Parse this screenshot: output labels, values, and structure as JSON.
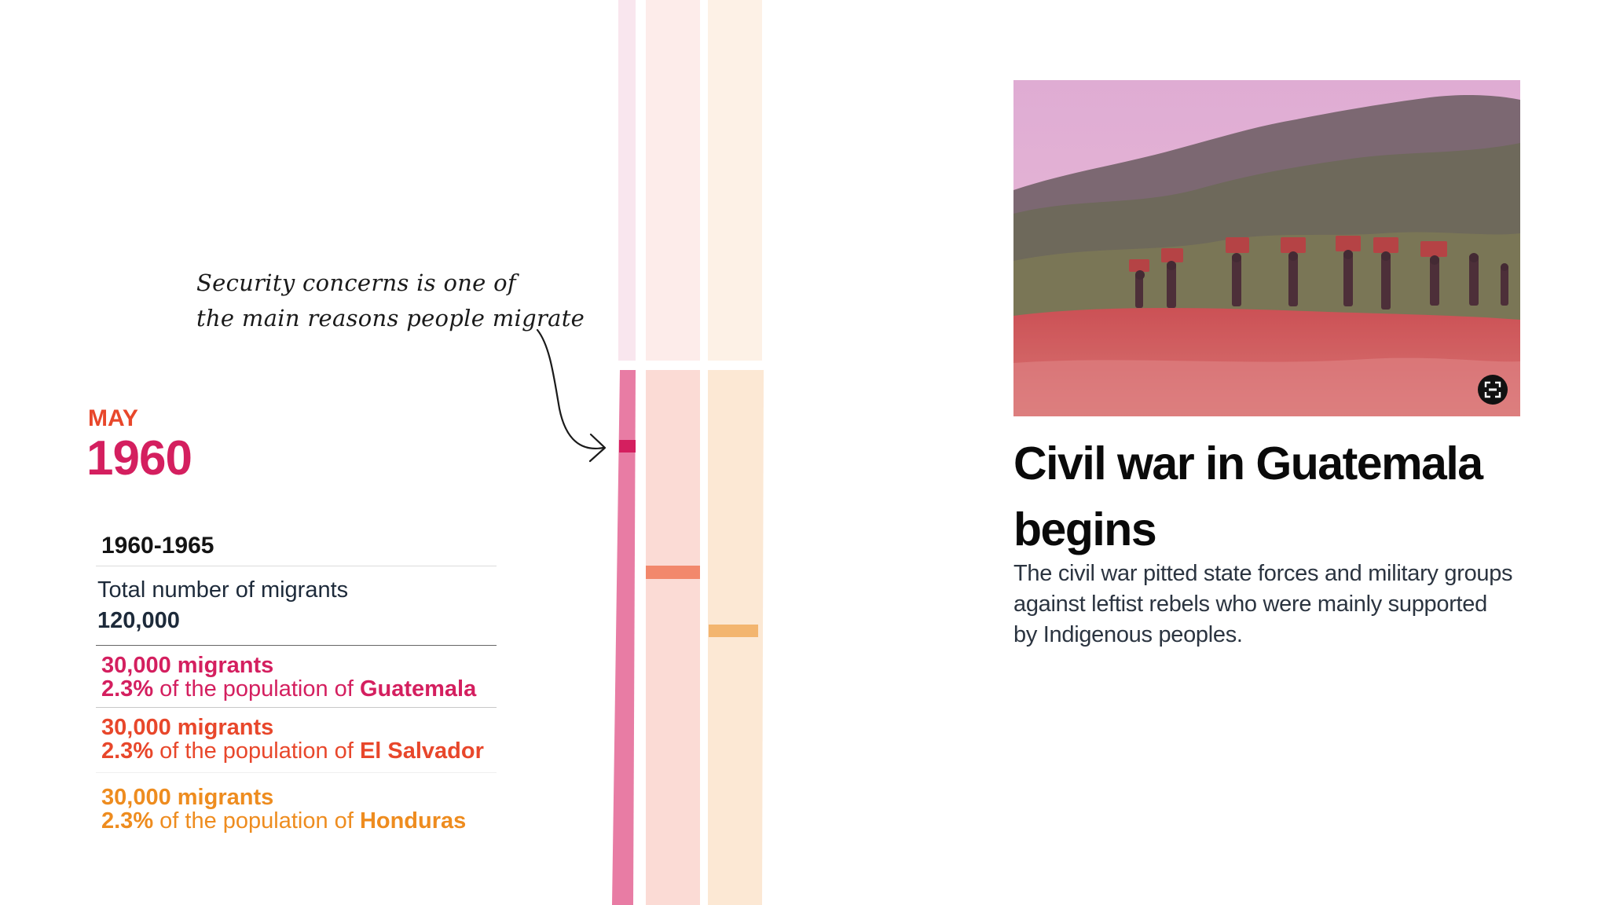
{
  "annotation": {
    "line1": "Security concerns is one of",
    "line2": "the main reasons people migrate"
  },
  "date": {
    "month": "MAY",
    "year": "1960"
  },
  "stats": {
    "period": "1960-1965",
    "total_label": "Total number of migrants",
    "total_value": "120,000",
    "countries": [
      {
        "migrants": "30,000 migrants",
        "percent": "2.3%",
        "text": "of the population of",
        "country": "Guatemala",
        "color": "#d41f5f"
      },
      {
        "migrants": "30,000 migrants",
        "percent": "2.3%",
        "text": "of the population of",
        "country": "El Salvador",
        "color": "#e8472b"
      },
      {
        "migrants": "30,000 migrants",
        "percent": "2.3%",
        "text": "of the population of",
        "country": "Honduras",
        "color": "#ee8c1f"
      }
    ]
  },
  "colors": {
    "guatemala": "#d41f5f",
    "el_salvador": "#e8472b",
    "honduras": "#ee8c1f"
  },
  "story": {
    "headline_line1": "Civil war in Guatemala",
    "headline_line2": "begins",
    "body": "The civil war pitted state forces and military groups against leftist rebels who were mainly supported by Indigenous peoples."
  },
  "icons": {
    "expand": "expand-icon"
  }
}
